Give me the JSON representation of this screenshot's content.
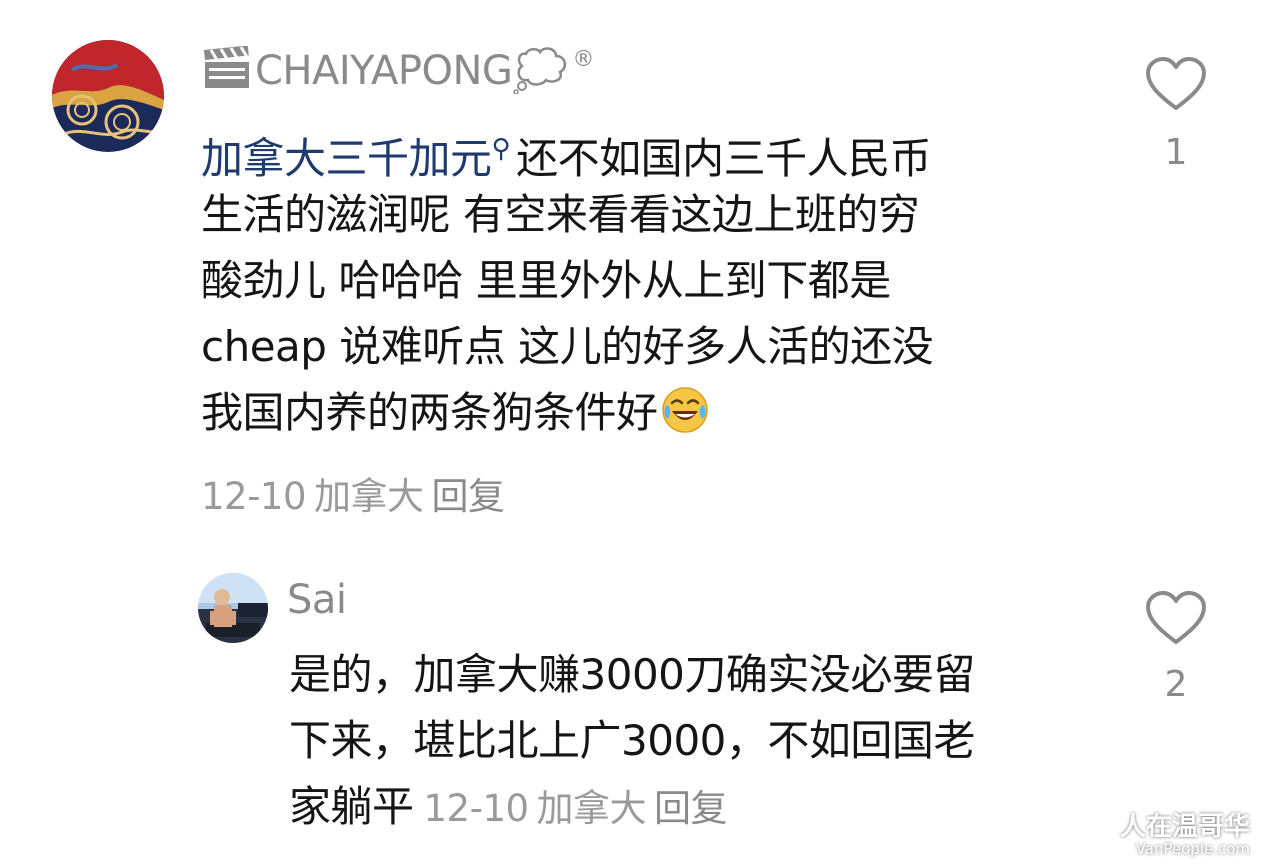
{
  "comments": [
    {
      "username": "CHAIYAPONG",
      "username_prefix_icon": "clapperboard-icon",
      "username_suffix_icon": "thought-bubble-icon",
      "username_mark": "®",
      "link_text": "加拿大三千加元",
      "text_lines": [
        "还不如国内三千人民币",
        "生活的滋润呢 有空来看看这边上班的穷",
        "酸劲儿 哈哈哈  里里外外从上到下都是",
        "cheap 说难听点 这儿的好多人活的还没",
        "我国内养的两条狗条件好"
      ],
      "trailing_emoji": "face-with-tears-of-joy-icon",
      "date": "12-10",
      "location": "加拿大",
      "reply_label": "回复",
      "likes": "1"
    },
    {
      "username": "Sai",
      "text_lines": [
        "是的，加拿大赚3000刀确实没必要留",
        "下来，堪比北上广3000，不如回国老",
        "家躺平"
      ],
      "date": "12-10",
      "location": "加拿大",
      "reply_label": "回复",
      "likes": "2"
    }
  ],
  "watermark": {
    "main": "人在温哥华",
    "sub": "VanPeople.com"
  },
  "colors": {
    "link": "#1e3a6e",
    "meta": "#9a9a9a",
    "text": "#151515"
  }
}
